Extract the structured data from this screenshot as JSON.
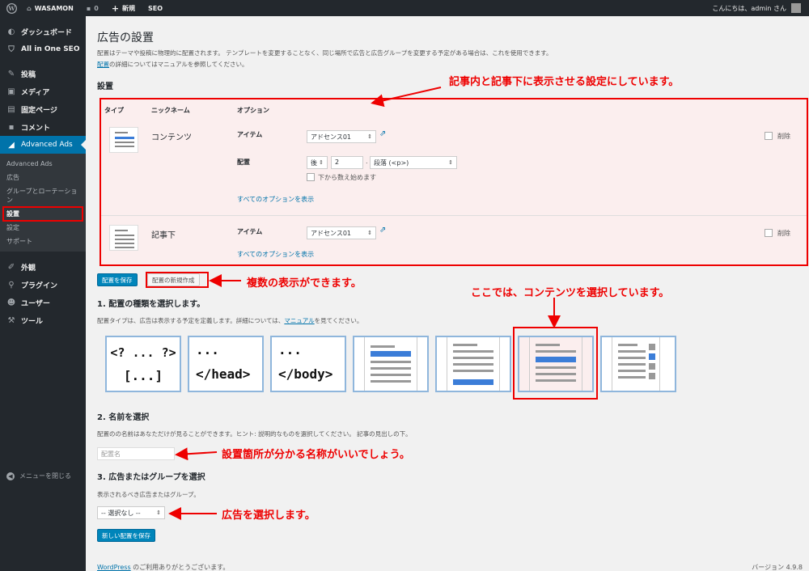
{
  "adminbar": {
    "site": "WASAMON",
    "comments": "0",
    "new": "新規",
    "seo": "SEO",
    "greeting": "こんにちは、admin さん"
  },
  "sidebar": {
    "items": [
      {
        "label": "ダッシュボード",
        "icon": "dashboard-icon"
      },
      {
        "label": "All in One SEO",
        "icon": "shield-icon"
      },
      {
        "label": "投稿",
        "icon": "pin-icon"
      },
      {
        "label": "メディア",
        "icon": "media-icon"
      },
      {
        "label": "固定ページ",
        "icon": "page-icon"
      },
      {
        "label": "コメント",
        "icon": "comment-icon"
      },
      {
        "label": "Advanced Ads",
        "icon": "chart-icon"
      }
    ],
    "submenu": [
      "Advanced Ads",
      "広告",
      "グループとローテーション",
      "設置",
      "設定",
      "サポート"
    ],
    "items2": [
      {
        "label": "外観",
        "icon": "brush-icon"
      },
      {
        "label": "プラグイン",
        "icon": "plugin-icon"
      },
      {
        "label": "ユーザー",
        "icon": "user-icon"
      },
      {
        "label": "ツール",
        "icon": "wrench-icon"
      }
    ],
    "collapse": "メニューを閉じる"
  },
  "page": {
    "title": "広告の設置",
    "desc1": "配置はテーマや投稿に物理的に配置されます。 テンプレートを変更することなく、同じ場所で広告と広告グループを変更する予定がある場合は、これを使用できます。",
    "desc2_link": "配置",
    "desc2_rest": "の詳細についてはマニュアルを参照してください。",
    "section": "設置"
  },
  "table": {
    "headers": [
      "タイプ",
      "ニックネーム",
      "オプション"
    ],
    "rows": [
      {
        "nickname": "コンテンツ",
        "item_label": "アイテム",
        "item_value": "アドセンス01",
        "placement_label": "配置",
        "position": "後",
        "number": "2",
        "dot": ".",
        "element": "段落 (<p>)",
        "count_from_bottom": "下から数え始めます",
        "show_all": "すべてのオプションを表示",
        "delete": "削除"
      },
      {
        "nickname": "記事下",
        "item_label": "アイテム",
        "item_value": "アドセンス01",
        "show_all": "すべてのオプションを表示",
        "delete": "削除"
      }
    ]
  },
  "buttons": {
    "save": "配置を保存",
    "new": "配置の新規作成",
    "save_new": "新しい配置を保存"
  },
  "step1": {
    "title": "1. 配置の種類を選択します。",
    "desc_a": "配置タイプは、広告は表示する予定を定義します。詳細については、",
    "desc_link": "マニュアル",
    "desc_b": "を見てください。"
  },
  "types": [
    {
      "l1": "<? ... ?>",
      "l2": "[...]"
    },
    {
      "l1": "...",
      "l2": "</head>"
    },
    {
      "l1": "...",
      "l2": "</body>"
    }
  ],
  "step2": {
    "title": "2. 名前を選択",
    "desc": "配置のの名前はあなただけが見ることができます。ヒント: 説明的なものを選択してください。 記事の見出しの下。",
    "placeholder": "配置名"
  },
  "step3": {
    "title": "3. 広告またはグループを選択",
    "desc": "表示されるべき広告またはグループ。",
    "select": "-- 選択なし --"
  },
  "footer": {
    "left_link": "WordPress",
    "left": " のご利用ありがとうございます。",
    "right": "バージョン 4.9.8"
  },
  "annotations": {
    "a1": "記事内と記事下に表示させる設定にしています。",
    "a2": "複数の表示ができます。",
    "a3": "ここでは、コンテンツを選択しています。",
    "a4": "設置箇所が分かる名称がいいでしょう。",
    "a5": "広告を選択します。"
  },
  "colors": {
    "accent": "#0073aa",
    "annotation": "#e00000",
    "sidebar": "#23282d"
  }
}
